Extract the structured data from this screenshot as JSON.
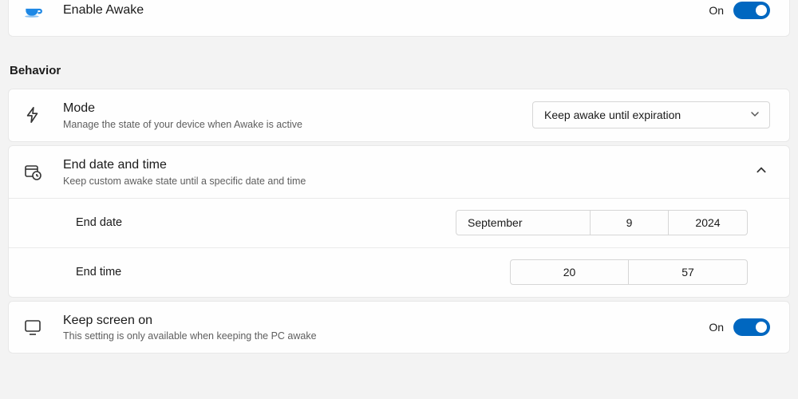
{
  "enable": {
    "title": "Enable Awake",
    "state": "On"
  },
  "section_behavior": "Behavior",
  "mode": {
    "title": "Mode",
    "desc": "Manage the state of your device when Awake is active",
    "value": "Keep awake until expiration"
  },
  "end_datetime": {
    "title": "End date and time",
    "desc": "Keep custom awake state until a specific date and time",
    "end_date_label": "End date",
    "month": "September",
    "day": "9",
    "year": "2024",
    "end_time_label": "End time",
    "hour": "20",
    "minute": "57"
  },
  "keep_screen": {
    "title": "Keep screen on",
    "desc": "This setting is only available when keeping the PC awake",
    "state": "On"
  }
}
